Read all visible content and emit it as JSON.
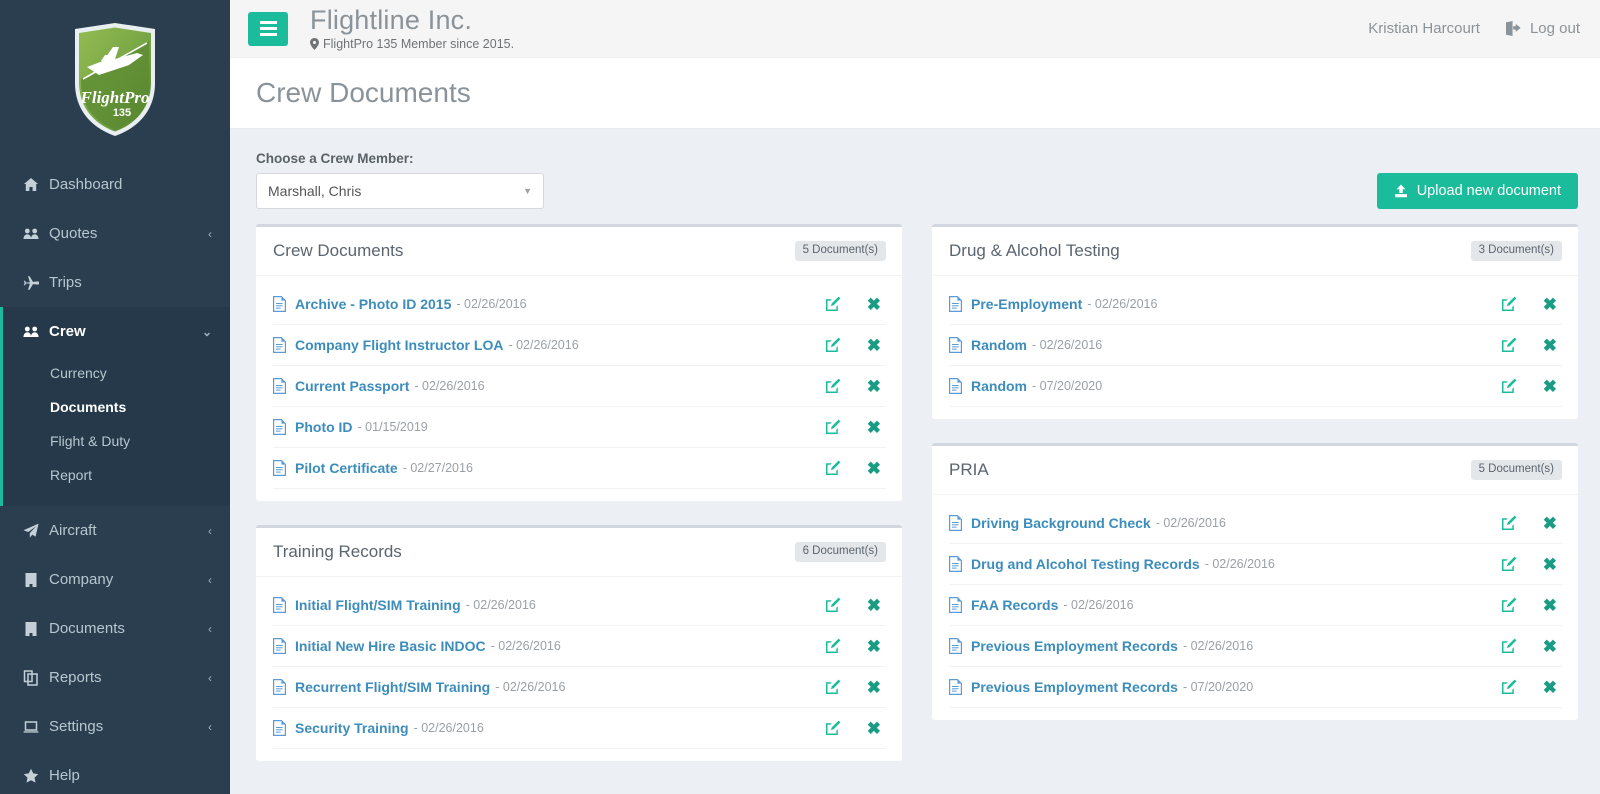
{
  "sidebar": {
    "logo": {
      "name": "flightpro-135-logo",
      "brand": "FlightPro",
      "number": "135"
    },
    "items": [
      {
        "label": "Dashboard",
        "icon": "home-icon",
        "chevron": ""
      },
      {
        "label": "Quotes",
        "icon": "users-icon",
        "chevron": "‹"
      },
      {
        "label": "Trips",
        "icon": "plane-icon",
        "chevron": ""
      },
      {
        "label": "Crew",
        "icon": "users-icon",
        "chevron": "⌄"
      },
      {
        "label": "Aircraft",
        "icon": "paper-plane-icon",
        "chevron": "‹"
      },
      {
        "label": "Company",
        "icon": "building-icon",
        "chevron": "‹"
      },
      {
        "label": "Documents",
        "icon": "building-icon",
        "chevron": "‹"
      },
      {
        "label": "Reports",
        "icon": "copy-icon",
        "chevron": "‹"
      },
      {
        "label": "Settings",
        "icon": "laptop-icon",
        "chevron": "‹"
      },
      {
        "label": "Help",
        "icon": "star-icon",
        "chevron": ""
      }
    ],
    "crew_subitems": [
      {
        "label": "Currency"
      },
      {
        "label": "Documents"
      },
      {
        "label": "Flight & Duty"
      },
      {
        "label": "Report"
      }
    ]
  },
  "header": {
    "menu_toggle": "menu-toggle",
    "company": "Flightline Inc.",
    "membership": "FlightPro 135 Member since 2015.",
    "user_name": "Kristian Harcourt",
    "logout_label": "Log out"
  },
  "page": {
    "title": "Crew Documents"
  },
  "toolbar": {
    "select_label": "Choose a Crew Member:",
    "selected_crew_member": "Marshall, Chris",
    "upload_label": "Upload new document"
  },
  "panels": [
    {
      "id": "crew-documents",
      "title": "Crew Documents",
      "badge": "5 Document(s)",
      "column": "left",
      "documents": [
        {
          "name": "Archive - Photo ID 2015",
          "date": "- 02/26/2016"
        },
        {
          "name": "Company Flight Instructor LOA",
          "date": "- 02/26/2016"
        },
        {
          "name": "Current Passport",
          "date": "- 02/26/2016"
        },
        {
          "name": "Photo ID",
          "date": "- 01/15/2019"
        },
        {
          "name": "Pilot Certificate",
          "date": "- 02/27/2016"
        }
      ]
    },
    {
      "id": "training-records",
      "title": "Training Records",
      "badge": "6 Document(s)",
      "column": "left",
      "documents": [
        {
          "name": "Initial Flight/SIM Training",
          "date": "- 02/26/2016"
        },
        {
          "name": "Initial New Hire Basic INDOC",
          "date": "- 02/26/2016"
        },
        {
          "name": "Recurrent Flight/SIM Training",
          "date": "- 02/26/2016"
        },
        {
          "name": "Security Training",
          "date": "- 02/26/2016"
        }
      ]
    },
    {
      "id": "drug-alcohol-testing",
      "title": "Drug & Alcohol Testing",
      "badge": "3 Document(s)",
      "column": "right",
      "documents": [
        {
          "name": "Pre-Employment",
          "date": "- 02/26/2016"
        },
        {
          "name": "Random",
          "date": "- 02/26/2016"
        },
        {
          "name": "Random",
          "date": "- 07/20/2020"
        }
      ]
    },
    {
      "id": "pria",
      "title": "PRIA",
      "badge": "5 Document(s)",
      "column": "right",
      "documents": [
        {
          "name": "Driving Background Check",
          "date": "- 02/26/2016"
        },
        {
          "name": "Drug and Alcohol Testing Records",
          "date": "- 02/26/2016"
        },
        {
          "name": "FAA Records",
          "date": "- 02/26/2016"
        },
        {
          "name": "Previous Employment Records",
          "date": "- 02/26/2016"
        },
        {
          "name": "Previous Employment Records",
          "date": "- 07/20/2020"
        }
      ]
    }
  ],
  "row_actions": {
    "edit": "edit-icon",
    "delete": "delete-icon",
    "delete_glyph": "✖"
  },
  "colors": {
    "sidebar_bg": "#2b3e50",
    "sidebar_active": "#25394a",
    "accent_teal": "#1abc9c",
    "link_blue": "#3c8dbc",
    "body_bg": "#ecf0f5"
  }
}
